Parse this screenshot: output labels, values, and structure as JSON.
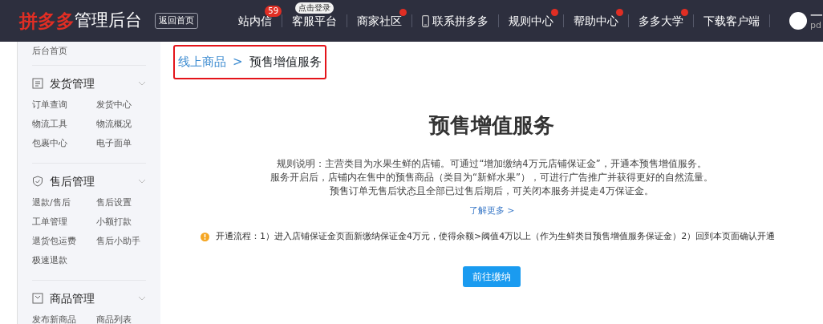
{
  "header": {
    "logo_brand": "拼多多",
    "logo_suffix": "管理后台",
    "back_button": "返回首页",
    "nav": [
      {
        "label": "站内信",
        "badge": "59",
        "dot": false,
        "kind": "text"
      },
      {
        "label": "客服平台",
        "tip": "点击登录",
        "dot": false,
        "kind": "text"
      },
      {
        "label": "商家社区",
        "dot": true,
        "kind": "text"
      },
      {
        "label": "联系拼多多",
        "dot": false,
        "kind": "phone"
      },
      {
        "label": "规则中心",
        "dot": true,
        "kind": "text"
      },
      {
        "label": "帮助中心",
        "dot": true,
        "kind": "text"
      },
      {
        "label": "多多大学",
        "dot": true,
        "kind": "text"
      },
      {
        "label": "下载客户端",
        "dot": false,
        "kind": "text"
      }
    ],
    "user": {
      "name": "一",
      "account": "pd"
    }
  },
  "sidebar": {
    "home": "后台首页",
    "groups": [
      {
        "title": "发货管理",
        "items": [
          {
            "label": "订单查询",
            "dot": false
          },
          {
            "label": "发货中心",
            "dot": false
          },
          {
            "label": "物流工具",
            "dot": false
          },
          {
            "label": "物流概况",
            "dot": false
          },
          {
            "label": "包裹中心",
            "dot": false
          },
          {
            "label": "电子面单",
            "dot": false
          }
        ]
      },
      {
        "title": "售后管理",
        "items": [
          {
            "label": "退款/售后",
            "dot": false
          },
          {
            "label": "售后设置",
            "dot": false
          },
          {
            "label": "工单管理",
            "dot": false
          },
          {
            "label": "小额打款",
            "dot": false
          },
          {
            "label": "退货包运费",
            "dot": false
          },
          {
            "label": "售后小助手",
            "dot": false
          },
          {
            "label": "极速退款",
            "dot": false
          }
        ]
      },
      {
        "title": "商品管理",
        "items": [
          {
            "label": "发布新商品",
            "dot": false
          },
          {
            "label": "商品列表",
            "dot": false
          }
        ]
      }
    ]
  },
  "breadcrumb": {
    "parent": "线上商品",
    "separator": ">",
    "current": "预售增值服务"
  },
  "main": {
    "title": "预售增值服务",
    "rules": [
      "规则说明：主营类目为水果生鲜的店铺。可通过“增加缴纳4万元店铺保证金”，开通本预售增值服务。",
      "服务开启后，店铺内在售中的预售商品（类目为“新鲜水果”），可进行广告推广并获得更好的自然流量。",
      "预售订单无售后状态且全部已过售后期后，可关闭本服务并提走4万保证金。"
    ],
    "more_link": "了解更多 >",
    "notice": "开通流程：1）进入店铺保证金页面新缴纳保证金4万元，使得余额>阈值4万以上（作为生鲜类目预售增值服务保证金）2）回到本页面确认开通",
    "button": "前往缴纳"
  }
}
